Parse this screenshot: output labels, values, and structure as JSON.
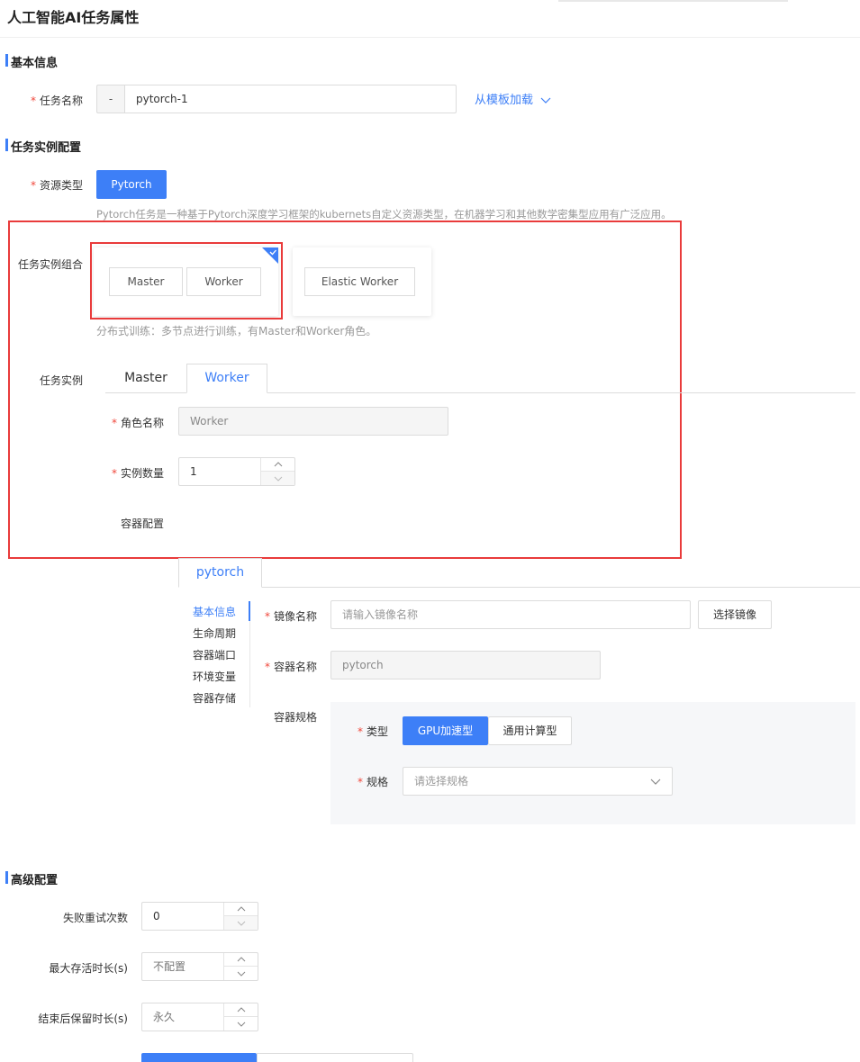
{
  "page": {
    "title": "人工智能AI任务属性"
  },
  "basic_info": {
    "section_title": "基本信息",
    "task_name_label": "任务名称",
    "task_name_prefix": "-",
    "task_name_value": "pytorch-1",
    "template_link": "从模板加载"
  },
  "instance_config": {
    "section_title": "任务实例配置",
    "resource_type_label": "资源类型",
    "resource_type_button": "Pytorch",
    "resource_type_help": "Pytorch任务是一种基于Pytorch深度学习框架的kubernets自定义资源类型，在机器学习和其他数学密集型应用有广泛应用。",
    "combo_label": "任务实例组合",
    "combo_options": [
      {
        "roles": [
          "Master",
          "Worker"
        ],
        "selected": true
      },
      {
        "roles": [
          "Elastic Worker"
        ],
        "selected": false
      }
    ],
    "combo_help": "分布式训练：多节点进行训练，有Master和Worker角色。",
    "instance_label": "任务实例",
    "instance_tabs": [
      "Master",
      "Worker"
    ],
    "active_instance_tab": "Worker",
    "role_name_label": "角色名称",
    "role_name_value": "Worker",
    "instance_count_label": "实例数量",
    "instance_count_value": "1",
    "container_config_label": "容器配置",
    "container_tab": "pytorch",
    "side_nav": [
      "基本信息",
      "生命周期",
      "容器端口",
      "环境变量",
      "容器存储"
    ],
    "image_name_label": "镜像名称",
    "image_name_placeholder": "请输入镜像名称",
    "select_image_button": "选择镜像",
    "container_name_label": "容器名称",
    "container_name_value": "pytorch",
    "container_spec_label": "容器规格",
    "type_label": "类型",
    "type_options": [
      "GPU加速型",
      "通用计算型"
    ],
    "spec_label": "规格",
    "spec_placeholder": "请选择规格"
  },
  "advanced": {
    "section_title": "高级配置",
    "retry_label": "失败重试次数",
    "retry_value": "0",
    "max_alive_label": "最大存活时长(s)",
    "max_alive_value": "不配置",
    "retain_label": "结束后保留时长(s)",
    "retain_value": "永久"
  },
  "colors": {
    "accent": "#3d7ff7",
    "highlight_box": "#e93b3b"
  }
}
